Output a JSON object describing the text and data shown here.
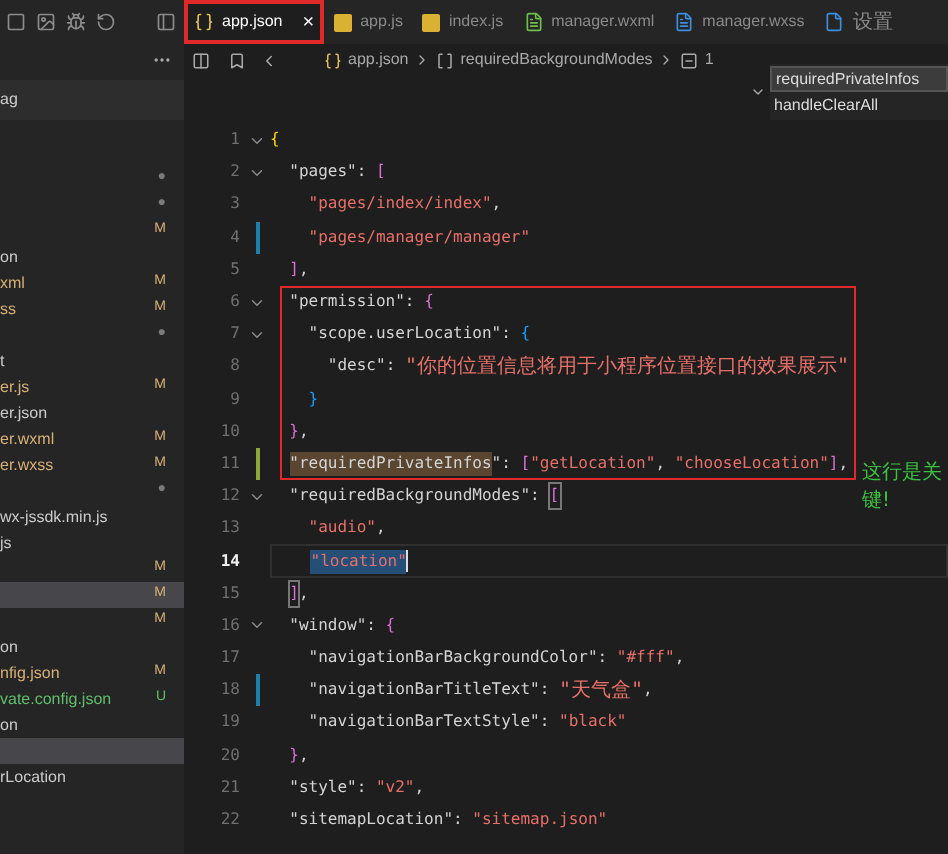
{
  "tabs": [
    {
      "label": "app.json",
      "kind": "json",
      "selected": true,
      "boxed": true,
      "close": "×"
    },
    {
      "label": "app.js",
      "kind": "js",
      "selected": false
    },
    {
      "label": "index.js",
      "kind": "js",
      "selected": false
    },
    {
      "label": "manager.wxml",
      "kind": "wxml",
      "selected": false
    },
    {
      "label": "manager.wxss",
      "kind": "wxss",
      "selected": false
    },
    {
      "label": "设置",
      "kind": "settings",
      "selected": false
    }
  ],
  "breadcrumb": [
    {
      "kind": "json",
      "text": "app.json"
    },
    {
      "kind": "array",
      "text": "requiredBackgroundModes"
    },
    {
      "kind": "item",
      "text": "1"
    }
  ],
  "sidebar": {
    "header": "ag",
    "items": [
      {
        "status": "●",
        "selected": false
      },
      {
        "status": "●",
        "selected": false
      },
      {
        "status": "M",
        "selected": false
      },
      {
        "text": "on",
        "selected": false
      },
      {
        "text": "xml",
        "status": "M",
        "selected": false
      },
      {
        "text": "ss",
        "status": "M",
        "selected": false
      },
      {
        "status": "●",
        "selected": false
      },
      {
        "text": "t",
        "selected": false
      },
      {
        "text": "er.js",
        "status": "M",
        "selected": false
      },
      {
        "text": "er.json",
        "selected": false
      },
      {
        "text": "er.wxml",
        "status": "M",
        "selected": false
      },
      {
        "text": "er.wxss",
        "status": "M",
        "selected": false
      },
      {
        "status": "●",
        "selected": false
      },
      {
        "text": "wx-jssdk.min.js",
        "selected": false
      },
      {
        "text": "js",
        "selected": false
      },
      {
        "status": "M",
        "selected": false
      },
      {
        "status": "M",
        "selected": true
      },
      {
        "status": "M",
        "selected": false
      },
      {
        "text": "on",
        "selected": false
      },
      {
        "text": "nfig.json",
        "status": "M",
        "selected": false
      },
      {
        "text": "vate.config.json",
        "status": "U",
        "selected": false
      },
      {
        "text": "on",
        "selected": false
      },
      {
        "selected": true
      },
      {
        "text": "rLocation",
        "selected": false
      }
    ]
  },
  "outline_dropdown": {
    "items": [
      {
        "text": "requiredPrivateInfos",
        "selected": true
      },
      {
        "text": "handleClearAll",
        "selected": false
      }
    ]
  },
  "code": {
    "lines": [
      {
        "number": "1",
        "selected": false,
        "foldable": true,
        "tokens": [
          {
            "kind": "brace-gold",
            "text": "{"
          }
        ]
      },
      {
        "number": "2",
        "selected": false,
        "foldable": true,
        "tokens": [
          {
            "kind": "key",
            "text": "\"pages\""
          },
          {
            "kind": "punct",
            "text": ":"
          },
          {
            "kind": "brace-pink",
            "text": "["
          }
        ]
      },
      {
        "number": "3",
        "selected": false,
        "tokens": [
          {
            "kind": "string",
            "text": "\"pages/index/index\""
          },
          {
            "kind": "punct",
            "text": ","
          }
        ]
      },
      {
        "number": "4",
        "selected": false,
        "color": "#1b81a8",
        "tokens": [
          {
            "kind": "string",
            "text": "\"pages/manager/manager\""
          }
        ]
      },
      {
        "number": "5",
        "selected": false,
        "tokens": [
          {
            "kind": "brace-pink",
            "text": "]"
          },
          {
            "kind": "punct",
            "text": ","
          }
        ]
      },
      {
        "number": "6",
        "selected": false,
        "foldable": true,
        "boxed": true,
        "tokens": [
          {
            "kind": "key",
            "text": "\"permission\""
          },
          {
            "kind": "punct",
            "text": ":"
          },
          {
            "kind": "brace-pink",
            "text": "{"
          }
        ]
      },
      {
        "number": "7",
        "selected": false,
        "foldable": true,
        "boxed": true,
        "tokens": [
          {
            "kind": "key",
            "text": "\"scope.userLocation\""
          },
          {
            "kind": "punct",
            "text": ":"
          },
          {
            "kind": "brace-blue",
            "text": "{"
          }
        ]
      },
      {
        "number": "8",
        "selected": false,
        "boxed": true,
        "tokens": [
          {
            "kind": "key",
            "text": "\"desc\""
          },
          {
            "kind": "punct",
            "text": ":"
          },
          {
            "kind": "string-cjk",
            "text": "\"你的位置信息将用于小程序位置接口的效果展示\""
          }
        ]
      },
      {
        "number": "9",
        "selected": false,
        "boxed": true,
        "tokens": [
          {
            "kind": "brace-blue",
            "text": "}"
          }
        ]
      },
      {
        "number": "10",
        "selected": false,
        "boxed": true,
        "tokens": [
          {
            "kind": "brace-pink",
            "text": "}"
          },
          {
            "kind": "punct",
            "text": ","
          }
        ]
      },
      {
        "number": "11",
        "selected": false,
        "color": "#8ca83b",
        "boxed": true,
        "tokens": [
          {
            "kind": "key-highlight",
            "text": "\"requiredPrivateInfos"
          },
          {
            "kind": "key",
            "text": "\""
          },
          {
            "kind": "punct",
            "text": ":"
          },
          {
            "kind": "brace-pink",
            "text": "["
          },
          {
            "kind": "string",
            "text": "\"getLocation\""
          },
          {
            "kind": "punct",
            "text": ","
          },
          {
            "kind": "string",
            "text": "\"chooseLocation\""
          },
          {
            "kind": "brace-pink",
            "text": "]"
          },
          {
            "kind": "punct",
            "text": ","
          }
        ]
      },
      {
        "number": "12",
        "selected": false,
        "foldable": true,
        "tokens": [
          {
            "kind": "key",
            "text": "\"requiredBackgroundModes\""
          },
          {
            "kind": "punct",
            "text": ":"
          },
          {
            "kind": "brace-match",
            "text": "["
          }
        ]
      },
      {
        "number": "13",
        "selected": false,
        "tokens": [
          {
            "kind": "string",
            "text": "\"audio\""
          },
          {
            "kind": "punct",
            "text": ","
          }
        ]
      },
      {
        "number": "14",
        "selected": true,
        "tokens": [
          {
            "kind": "string-selected",
            "text": "\"location\""
          }
        ]
      },
      {
        "number": "15",
        "selected": false,
        "tokens": [
          {
            "kind": "brace-match",
            "text": "]"
          },
          {
            "kind": "punct",
            "text": ","
          }
        ]
      },
      {
        "number": "16",
        "selected": false,
        "foldable": true,
        "tokens": [
          {
            "kind": "key",
            "text": "\"window\""
          },
          {
            "kind": "punct",
            "text": ":"
          },
          {
            "kind": "brace-pink",
            "text": "{"
          }
        ]
      },
      {
        "number": "17",
        "selected": false,
        "tokens": [
          {
            "kind": "key",
            "text": "\"navigationBarBackgroundColor\""
          },
          {
            "kind": "punct",
            "text": ":"
          },
          {
            "kind": "string",
            "text": "\"#fff\""
          },
          {
            "kind": "punct",
            "text": ","
          }
        ]
      },
      {
        "number": "18",
        "selected": false,
        "color": "#1b81a8",
        "tokens": [
          {
            "kind": "key",
            "text": "\"navigationBarTitleText\""
          },
          {
            "kind": "punct",
            "text": ":"
          },
          {
            "kind": "string-cjk",
            "text": "\"天气盒\""
          },
          {
            "kind": "punct",
            "text": ","
          }
        ]
      },
      {
        "number": "19",
        "selected": false,
        "tokens": [
          {
            "kind": "key",
            "text": "\"navigationBarTextStyle\""
          },
          {
            "kind": "punct",
            "text": ":"
          },
          {
            "kind": "string",
            "text": "\"black\""
          }
        ]
      },
      {
        "number": "20",
        "selected": false,
        "tokens": [
          {
            "kind": "brace-pink",
            "text": "}"
          },
          {
            "kind": "punct",
            "text": ","
          }
        ]
      },
      {
        "number": "21",
        "selected": false,
        "tokens": [
          {
            "kind": "key",
            "text": "\"style\""
          },
          {
            "kind": "punct",
            "text": ":"
          },
          {
            "kind": "string",
            "text": "\"v2\""
          },
          {
            "kind": "punct",
            "text": ","
          }
        ]
      },
      {
        "number": "22",
        "selected": false,
        "tokens": [
          {
            "kind": "key",
            "text": "\"sitemapLocation\""
          },
          {
            "kind": "punct",
            "text": ":"
          },
          {
            "kind": "string",
            "text": "\"sitemap.json\""
          }
        ]
      }
    ]
  },
  "annotation": {
    "text": "这行是关键!"
  }
}
